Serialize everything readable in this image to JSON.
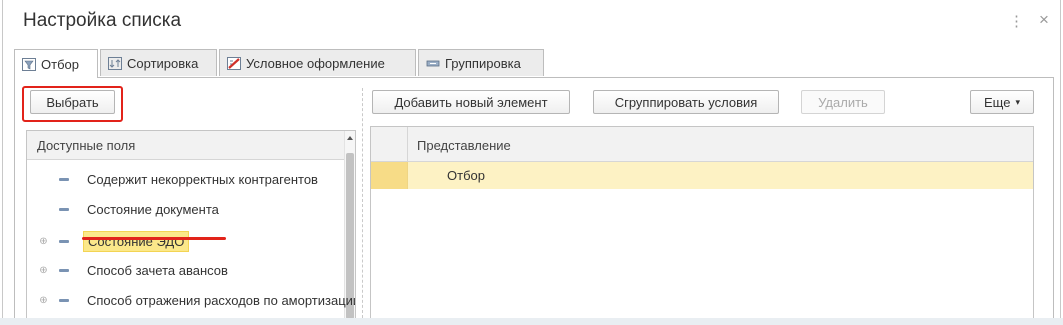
{
  "window": {
    "title": "Настройка списка",
    "menu_glyph": "⋮",
    "close_glyph": "×"
  },
  "tabs": [
    {
      "label": "Отбор",
      "icon": "filter-icon",
      "active": true
    },
    {
      "label": "Сортировка",
      "icon": "sort-icon",
      "active": false
    },
    {
      "label": "Условное оформление",
      "icon": "conditional-format-icon",
      "active": false
    },
    {
      "label": "Группировка",
      "icon": "grouping-icon",
      "active": false
    }
  ],
  "left": {
    "select_button": "Выбрать",
    "list_header": "Доступные поля",
    "items": [
      {
        "label": "Содержит некорректных контрагентов",
        "expandable": false
      },
      {
        "label": "Состояние документа",
        "expandable": false
      },
      {
        "label": "Состояние ЭДО",
        "expandable": true,
        "highlighted": true
      },
      {
        "label": "Способ зачета авансов",
        "expandable": true
      },
      {
        "label": "Способ отражения расходов по амортизации",
        "expandable": true
      }
    ]
  },
  "right": {
    "toolbar": {
      "add_label": "Добавить новый элемент",
      "group_label": "Сгруппировать условия",
      "delete_label": "Удалить",
      "more_label": "Еще"
    },
    "table": {
      "column_header": "Представление",
      "rows": [
        {
          "label": "Отбор",
          "selected": true
        }
      ]
    }
  },
  "colors": {
    "accent_red": "#e2231a",
    "highlight_yellow": "#fbe88a",
    "selected_row": "#fdf2c4"
  }
}
